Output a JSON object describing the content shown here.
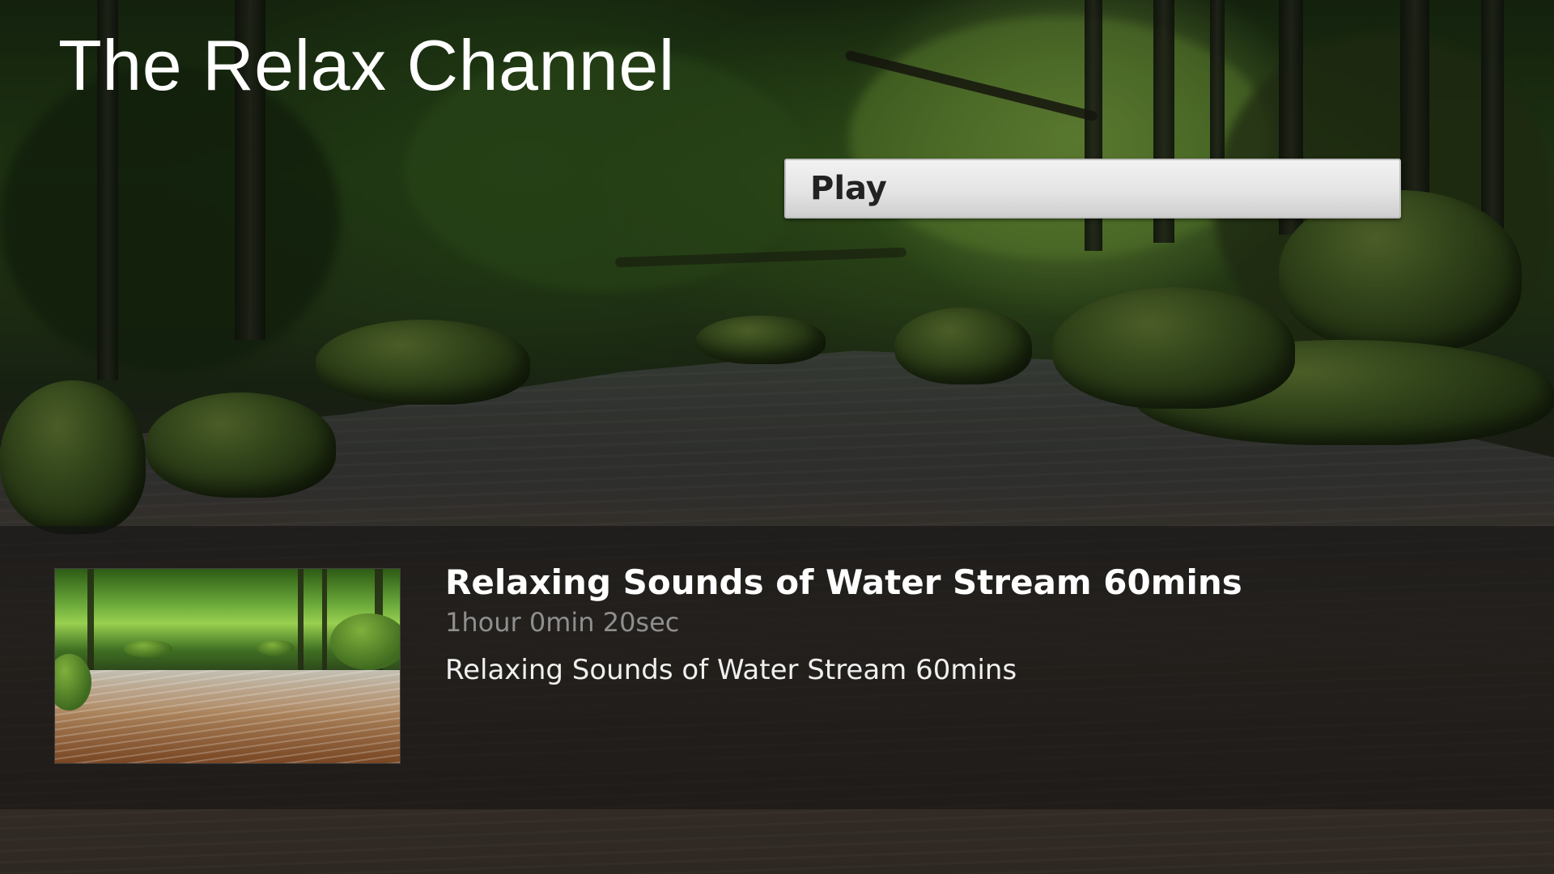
{
  "channel": {
    "title": "The Relax Channel"
  },
  "actions": {
    "play_label": "Play"
  },
  "video": {
    "title": "Relaxing Sounds of Water Stream 60mins",
    "duration": "1hour 0min 20sec",
    "description": "Relaxing Sounds of Water Stream 60mins",
    "thumbnail": "forest-stream-thumbnail"
  },
  "background": {
    "scene": "forest-stream-background"
  },
  "colors": {
    "button_bg": "#e6e6e6",
    "button_text": "#222222",
    "panel_bg": "#141414",
    "title_text": "#ffffff",
    "duration_text": "#8f8f8f"
  }
}
